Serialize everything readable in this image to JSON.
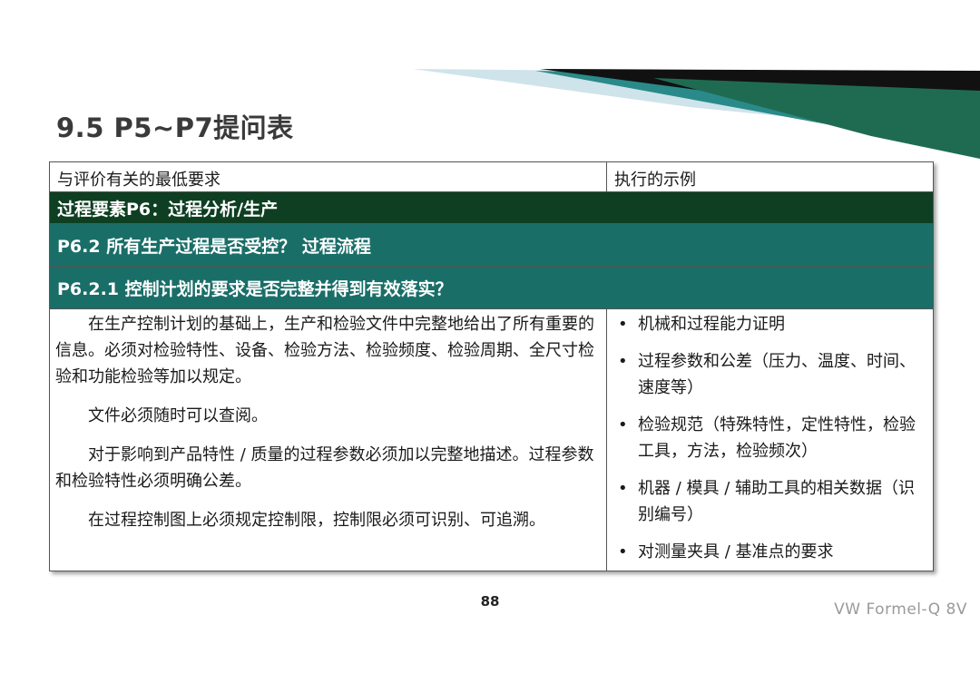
{
  "slide": {
    "title": "9.5  P5~P7提问表",
    "page_number": "88",
    "footer_brand": "VW Formel-Q  8V"
  },
  "table": {
    "header": {
      "col1": "与评价有关的最低要求",
      "col2": "执行的示例"
    },
    "element_row": "过程要素P6：过程分析/生产",
    "section_row": "P6.2  所有生产过程是否受控？  过程流程",
    "question_row": "P6.2.1  控制计划的要求是否完整并得到有效落实？",
    "requirements": [
      "在生产控制计划的基础上，生产和检验文件中完整地给出了所有重要的信息。必须对检验特性、设备、检验方法、检验频度、检验周期、全尺寸检验和功能检验等加以规定。",
      "文件必须随时可以查阅。",
      "对于影响到产品特性 / 质量的过程参数必须加以完整地描述。过程参数和检验特性必须明确公差。",
      "在过程控制图上必须规定控制限，控制限必须可识别、可追溯。"
    ],
    "examples": [
      "机械和过程能力证明",
      "过程参数和公差（压力、温度、时间、速度等）",
      "检验规范（特殊特性，定性特性，检验工具，方法，检验频次）",
      "机器 / 模具 / 辅助工具的相关数据（识别编号）",
      "对测量夹具 / 基准点的要求"
    ],
    "bullet_glyph": "•"
  },
  "colors": {
    "element_band": "#0e3f22",
    "section_band": "#1a6e68",
    "title_text": "#3a3a3a"
  }
}
